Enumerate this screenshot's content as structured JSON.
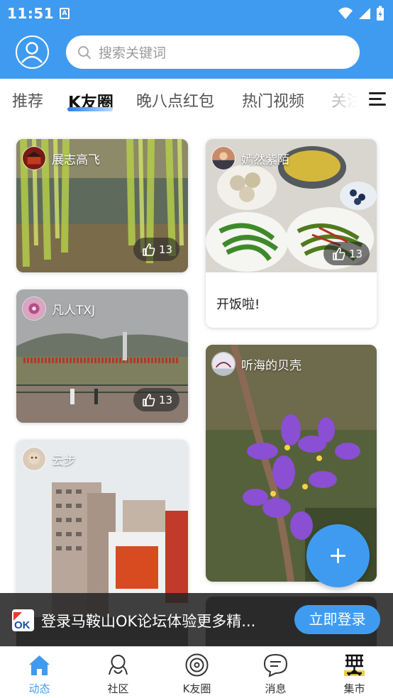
{
  "status_bar": {
    "time": "11:51",
    "notification_glyph": "A"
  },
  "header": {
    "search_placeholder": "搜索关键词",
    "icons": [
      "user-avatar-icon",
      "search-icon"
    ]
  },
  "tabs": [
    {
      "label": "推荐",
      "active": false
    },
    {
      "label": "K友圈",
      "active": true
    },
    {
      "label": "晚八点红包",
      "active": false
    },
    {
      "label": "热门视频",
      "active": false
    },
    {
      "label": "关注",
      "active": false
    }
  ],
  "posts": [
    {
      "user": "展志高飞",
      "likes": "13",
      "caption": ""
    },
    {
      "user": "嫣然紫陌",
      "likes": "13",
      "caption": "开饭啦!"
    },
    {
      "user": "凡人TXJ",
      "likes": "13",
      "caption": ""
    },
    {
      "user": "听海的贝壳",
      "likes": "",
      "caption": ""
    },
    {
      "user": "云步",
      "likes": "",
      "caption": ""
    }
  ],
  "fab": {
    "icon": "plus-icon"
  },
  "login_banner": {
    "logo_text": "OK",
    "text": "登录马鞍山OK论坛体验更多精...",
    "button": "立即登录"
  },
  "bottom_nav": [
    {
      "label": "动态",
      "icon": "home-icon",
      "active": true
    },
    {
      "label": "社区",
      "icon": "community-icon",
      "active": false
    },
    {
      "label": "K友圈",
      "icon": "k-circle-icon",
      "active": false
    },
    {
      "label": "消息",
      "icon": "message-icon",
      "active": false
    },
    {
      "label": "集市",
      "icon": "market-icon",
      "active": false
    }
  ],
  "colors": {
    "primary": "#3f9bf0",
    "banner_bg": "#262626"
  }
}
